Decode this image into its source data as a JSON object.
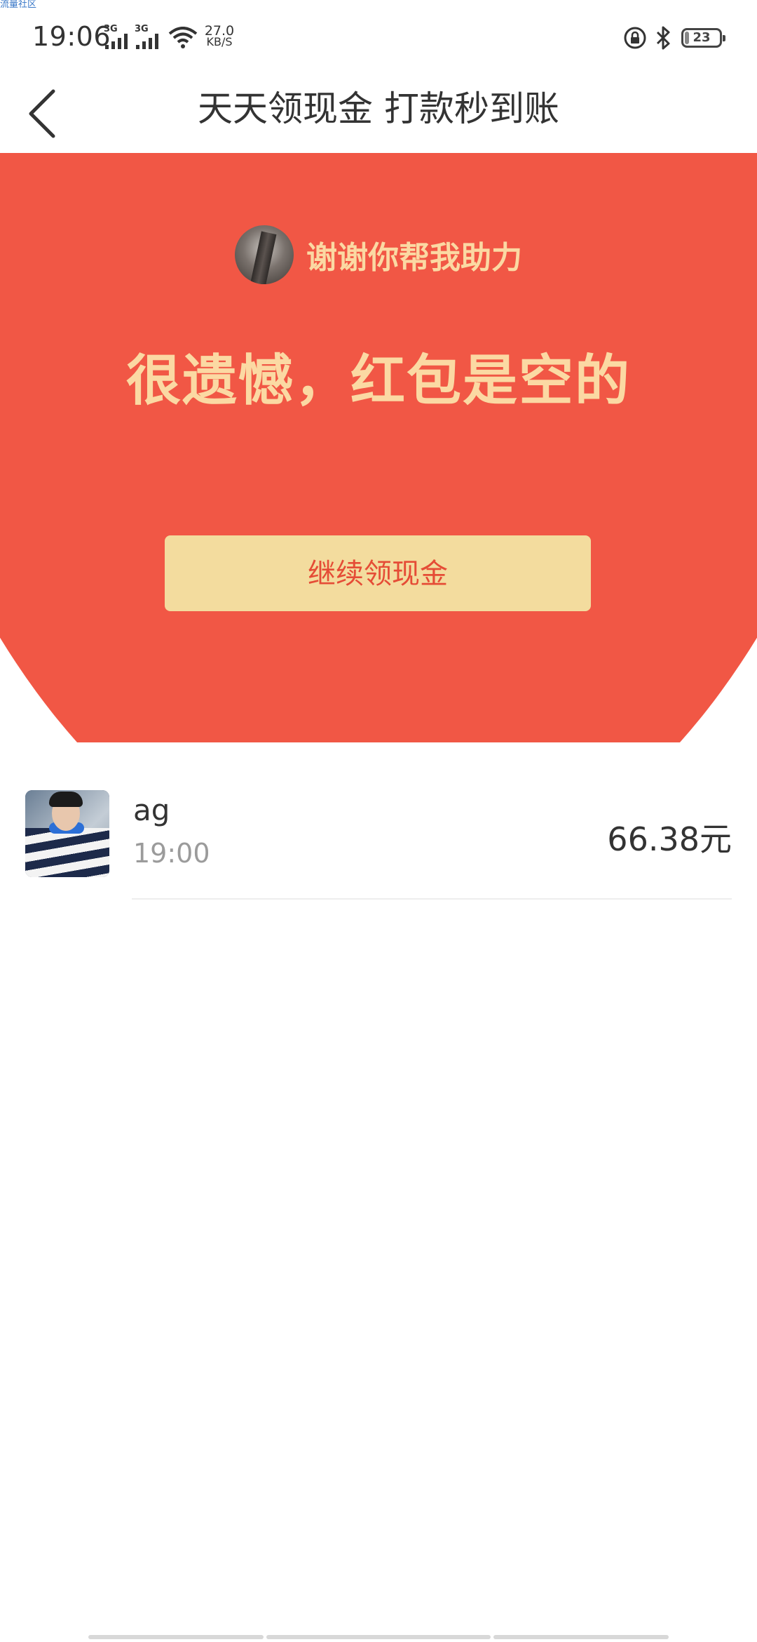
{
  "watermark": "流量社区",
  "status_bar": {
    "time": "19:06",
    "signal_1": "3G",
    "signal_2": "3G",
    "speed_value": "27.0",
    "speed_unit": "KB/S",
    "battery": "23"
  },
  "header": {
    "title": "天天领现金 打款秒到账"
  },
  "hero": {
    "helper_text": "谢谢你帮我助力",
    "empty_title": "很遗憾，红包是空的",
    "continue_label": "继续领现金",
    "background_color": "#f15745",
    "text_color": "#fbd9a3",
    "button_color": "#f3dc9e"
  },
  "list": {
    "items": [
      {
        "name": "ag",
        "time": "19:00",
        "amount": "66.38元"
      }
    ]
  }
}
